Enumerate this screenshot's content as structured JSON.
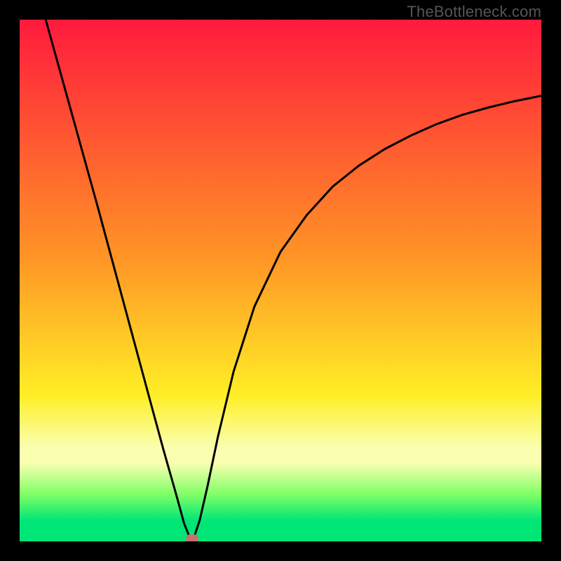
{
  "watermark": "TheBottleneck.com",
  "colors": {
    "frame_bg": "#000000",
    "red": "#ff1a3d",
    "orange": "#ff9326",
    "yellow": "#ffee26",
    "cream": "#faffb0",
    "lime": "#7fff66",
    "green": "#00e676",
    "curve": "#000000",
    "dot": "#c4726e"
  },
  "chart_data": {
    "type": "line",
    "title": "",
    "xlabel": "",
    "ylabel": "",
    "xlim": [
      0,
      1
    ],
    "ylim": [
      0,
      1
    ],
    "x": [
      0.05,
      0.1,
      0.15,
      0.2,
      0.25,
      0.275,
      0.3,
      0.315,
      0.325,
      0.335,
      0.345,
      0.36,
      0.38,
      0.41,
      0.45,
      0.5,
      0.55,
      0.6,
      0.65,
      0.7,
      0.75,
      0.8,
      0.85,
      0.9,
      0.95,
      1.0
    ],
    "y": [
      1.0,
      0.82,
      0.64,
      0.455,
      0.27,
      0.178,
      0.09,
      0.035,
      0.01,
      0.01,
      0.04,
      0.105,
      0.2,
      0.325,
      0.45,
      0.555,
      0.625,
      0.68,
      0.72,
      0.752,
      0.778,
      0.8,
      0.818,
      0.832,
      0.844,
      0.854
    ],
    "min_point": {
      "x": 0.33,
      "y": 0.005
    },
    "gradient_stops_pct": [
      0,
      45,
      72,
      82,
      85,
      91,
      96,
      100
    ],
    "gradient_colors": [
      "red",
      "orange",
      "yellow",
      "cream",
      "cream",
      "lime",
      "green",
      "green"
    ],
    "curve_note": "V-shaped bottleneck curve; y-axis inverted visually (0 at bottom = best, 1 at top = worst)"
  }
}
